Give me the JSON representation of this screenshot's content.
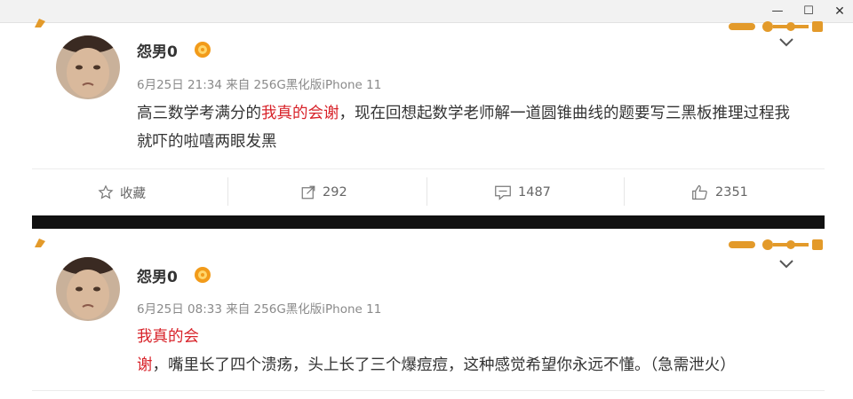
{
  "window": {
    "controls": {
      "minimize": "—",
      "maximize": "☐",
      "close": "✕"
    }
  },
  "posts": [
    {
      "username": "怨男0",
      "date": "6月25日 21:34",
      "source": "来自 256G黑化版iPhone 11",
      "highlight": "我真的会谢",
      "text_before": "高三数学考满分的",
      "text_after": "，现在回想起数学老师解一道圆锥曲线的题要写三黑板推理过程我就吓的啦嘻两眼发黑",
      "actions": {
        "favorite": "收藏",
        "repost": "292",
        "comment": "1487",
        "like": "2351"
      }
    },
    {
      "username": "怨男0",
      "date": "6月25日 08:33",
      "source": "来自 256G黑化版iPhone 11",
      "highlight": "我真的会谢",
      "text_before": "",
      "text_after": "，嘴里长了四个溃疡，头上长了三个爆痘痘，这种感觉希望你永远不懂。（急需泄火）"
    }
  ],
  "colors": {
    "highlight": "#d8232a",
    "meta": "#8a8a8a",
    "vip_badge": "#f29b1a",
    "decoration": "#e39a2a"
  }
}
